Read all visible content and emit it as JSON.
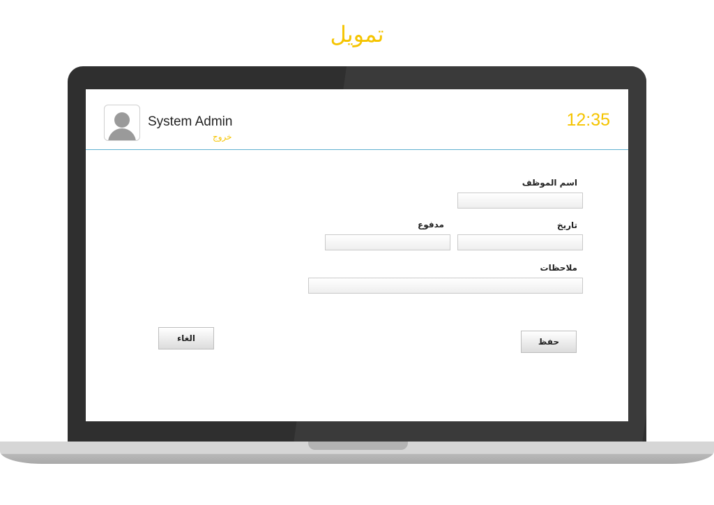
{
  "page": {
    "title": "تمويل"
  },
  "header": {
    "user_name": "System Admin",
    "logout_label": "خروج",
    "clock": "12:35",
    "avatar_icon": "user-avatar-icon"
  },
  "form": {
    "employee_name": {
      "label": "اسم الموظف",
      "value": ""
    },
    "date": {
      "label": "تاريخ",
      "value": ""
    },
    "paid": {
      "label": "مدفوع",
      "value": ""
    },
    "notes": {
      "label": "ملاحظات",
      "value": ""
    }
  },
  "actions": {
    "save_label": "حفظ",
    "cancel_label": "الغاء"
  },
  "colors": {
    "accent": "#f5c400",
    "divider": "#5fb0d0",
    "laptop_frame": "#2f2f2f"
  }
}
